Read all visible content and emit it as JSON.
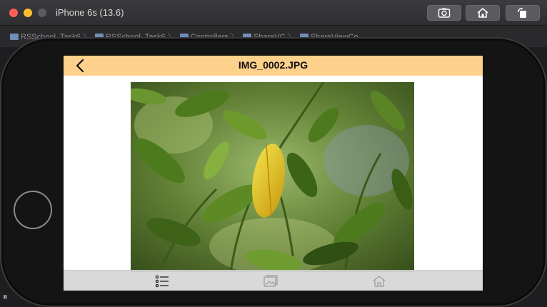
{
  "simulator": {
    "window_title": "iPhone 6s (13.6)",
    "toolbar_icons": [
      "screenshot-icon",
      "home-icon",
      "rotate-icon"
    ]
  },
  "xcode": {
    "breadcrumbs": [
      "RSSchool_Task6",
      "RSSchool_Task6",
      "Controllers",
      "ShareVC",
      "ShareViewCo..."
    ]
  },
  "app": {
    "nav_title": "IMG_0002.JPG",
    "back_icon": "chevron-left-icon",
    "nav_color": "#fdd08b",
    "photo_description_icon": "photo-image",
    "tabs": [
      {
        "icon": "list-icon",
        "active": true
      },
      {
        "icon": "gallery-icon",
        "active": false
      },
      {
        "icon": "home-icon",
        "active": false
      }
    ]
  },
  "colors": {
    "traffic_red": "#ff5f57",
    "traffic_yellow": "#febc2e",
    "tabbar_bg": "#d6d6d6"
  }
}
